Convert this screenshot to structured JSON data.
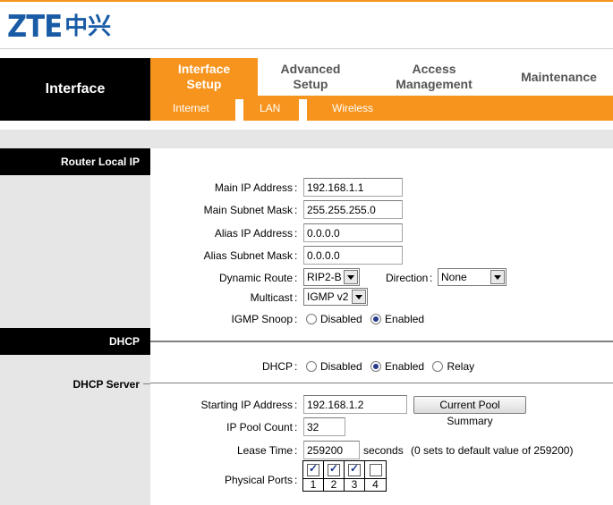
{
  "brand": {
    "logo_latin": "ZTE",
    "logo_cjk": "中兴"
  },
  "nav": {
    "section_title": "Interface",
    "tabs": [
      {
        "label": "Interface\nSetup",
        "active": true
      },
      {
        "label": "Advanced\nSetup",
        "active": false
      },
      {
        "label": "Access\nManagement",
        "active": false
      },
      {
        "label": "Maintenance",
        "active": false
      }
    ],
    "subtabs": [
      "Internet",
      "LAN",
      "Wireless"
    ]
  },
  "router_local_ip": {
    "section_title": "Router Local IP",
    "main_ip_label": "Main IP Address",
    "main_ip_value": "192.168.1.1",
    "main_subnet_label": "Main Subnet Mask",
    "main_subnet_value": "255.255.255.0",
    "alias_ip_label": "Alias IP Address",
    "alias_ip_value": "0.0.0.0",
    "alias_subnet_label": "Alias Subnet Mask",
    "alias_subnet_value": "0.0.0.0",
    "dynamic_route_label": "Dynamic Route",
    "dynamic_route_value": "RIP2-B",
    "direction_label": "Direction",
    "direction_value": "None",
    "multicast_label": "Multicast",
    "multicast_value": "IGMP v2",
    "igmp_snoop_label": "IGMP Snoop",
    "igmp_options": [
      "Disabled",
      "Enabled"
    ],
    "igmp_selected": "Enabled"
  },
  "dhcp": {
    "section_title": "DHCP",
    "dhcp_label": "DHCP",
    "dhcp_options": [
      "Disabled",
      "Enabled",
      "Relay"
    ],
    "dhcp_selected": "Enabled",
    "server_section_title": "DHCP Server",
    "start_ip_label": "Starting IP Address",
    "start_ip_value": "192.168.1.2",
    "pool_summary_button": "Current Pool Summary",
    "pool_count_label": "IP Pool Count",
    "pool_count_value": "32",
    "lease_label": "Lease Time",
    "lease_value": "259200",
    "lease_unit": "seconds",
    "lease_note": "(0 sets to default value of 259200)",
    "ports_label": "Physical Ports",
    "ports": [
      {
        "num": "1",
        "checked": true
      },
      {
        "num": "2",
        "checked": true
      },
      {
        "num": "3",
        "checked": true
      },
      {
        "num": "4",
        "checked": false
      }
    ]
  },
  "colors": {
    "orange": "#f7941e",
    "brand_blue": "#1a5ba6",
    "sidebar_gray": "#e6e6e6"
  }
}
